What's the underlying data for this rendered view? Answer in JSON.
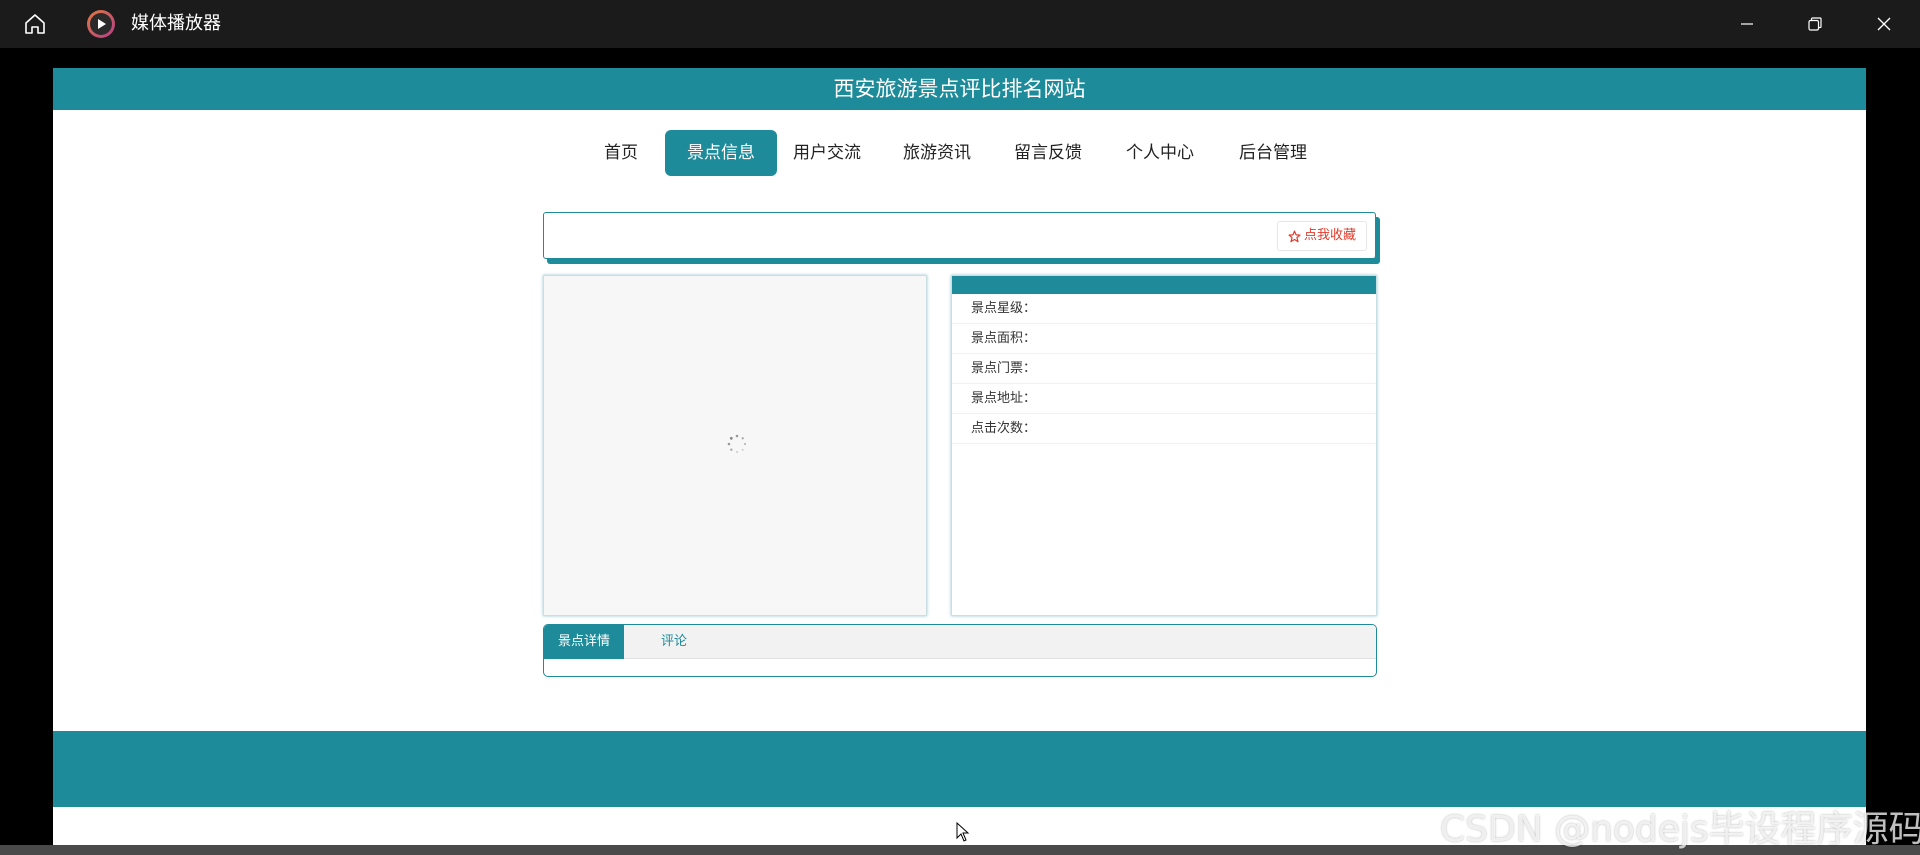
{
  "player": {
    "title": "媒体播放器",
    "icons": [
      "home-icon",
      "play-icon",
      "minimize-icon",
      "restore-icon",
      "close-icon"
    ]
  },
  "site": {
    "title": "西安旅游景点评比排名网站",
    "accent_color": "#1e8b9b",
    "nav": [
      {
        "label": "首页",
        "active": false
      },
      {
        "label": "景点信息",
        "active": true
      },
      {
        "label": "用户交流",
        "active": false
      },
      {
        "label": "旅游资讯",
        "active": false
      },
      {
        "label": "留言反馈",
        "active": false
      },
      {
        "label": "个人中心",
        "active": false
      },
      {
        "label": "后台管理",
        "active": false
      }
    ],
    "favorite_button": "点我收藏",
    "info_fields": [
      {
        "label": "景点星级："
      },
      {
        "label": "景点面积："
      },
      {
        "label": "景点门票："
      },
      {
        "label": "景点地址："
      },
      {
        "label": "点击次数："
      }
    ],
    "tabs": [
      {
        "label": "景点详情",
        "active": true
      },
      {
        "label": "评论",
        "active": false
      }
    ]
  },
  "watermark": "CSDN @nodejs毕设程序源码"
}
